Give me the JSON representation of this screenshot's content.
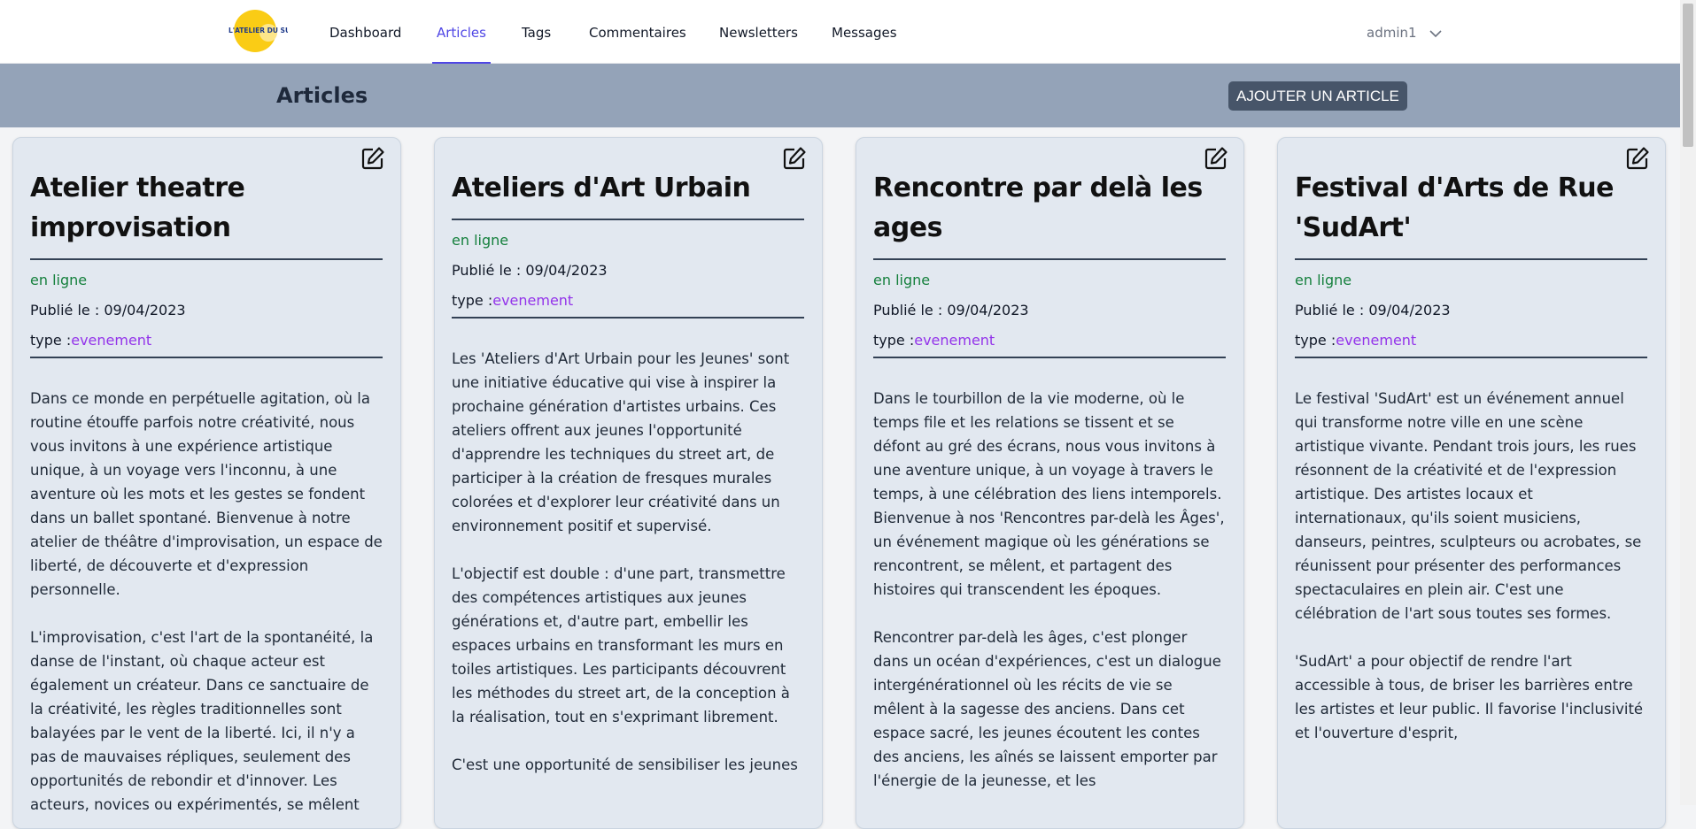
{
  "nav": {
    "items": [
      {
        "label": "Dashboard"
      },
      {
        "label": "Articles"
      },
      {
        "label": "Tags"
      },
      {
        "label": "Commentaires"
      },
      {
        "label": "Newsletters"
      },
      {
        "label": "Messages"
      }
    ],
    "active": "Articles",
    "user": "admin1"
  },
  "logo": {
    "text_line1": "L'ATELIER DU SUD"
  },
  "header": {
    "title": "Articles",
    "add_button": "AJOUTER UN ARTICLE"
  },
  "articles": [
    {
      "title": "Atelier theatre improvisation",
      "status": "en ligne",
      "published": "Publié le : 09/04/2023",
      "type_label": "type :",
      "type_value": "evenement",
      "paragraphs": [
        "Dans ce monde en perpétuelle agitation, où la routine étouffe parfois notre créativité, nous vous invitons à une expérience artistique unique, à un voyage vers l'inconnu, à une aventure où les mots et les gestes se fondent dans un ballet spontané. Bienvenue à notre atelier de théâtre d'improvisation, un espace de liberté, de découverte et d'expression personnelle.",
        "L'improvisation, c'est l'art de la spontanéité, la danse de l'instant, où chaque acteur est également un créateur. Dans ce sanctuaire de la créativité, les règles traditionnelles sont balayées par le vent de la liberté. Ici, il n'y a pas de mauvaises répliques, seulement des opportunités de rebondir et d'innover. Les acteurs, novices ou expérimentés, se mêlent"
      ]
    },
    {
      "title": "Ateliers d'Art Urbain",
      "status": "en ligne",
      "published": "Publié le : 09/04/2023",
      "type_label": "type :",
      "type_value": "evenement",
      "paragraphs": [
        "Les 'Ateliers d'Art Urbain pour les Jeunes' sont une initiative éducative qui vise à inspirer la prochaine génération d'artistes urbains. Ces ateliers offrent aux jeunes l'opportunité d'apprendre les techniques du street art, de participer à la création de fresques murales colorées et d'explorer leur créativité dans un environnement positif et supervisé.",
        "L'objectif est double : d'une part, transmettre des compétences artistiques aux jeunes générations et, d'autre part, embellir les espaces urbains en transformant les murs en toiles artistiques. Les participants découvrent les méthodes du street art, de la conception à la réalisation, tout en s'exprimant librement.",
        "C'est une opportunité de sensibiliser les jeunes"
      ]
    },
    {
      "title": "Rencontre par delà les ages",
      "status": "en ligne",
      "published": "Publié le : 09/04/2023",
      "type_label": "type :",
      "type_value": "evenement",
      "paragraphs": [
        "Dans le tourbillon de la vie moderne, où le temps file et les relations se tissent et se défont au gré des écrans, nous vous invitons à une aventure unique, à un voyage à travers le temps, à une célébration des liens intemporels. Bienvenue à nos 'Rencontres par-delà les Âges', un événement magique où les générations se rencontrent, se mêlent, et partagent des histoires qui transcendent les époques.",
        "Rencontrer par-delà les âges, c'est plonger dans un océan d'expériences, c'est un dialogue intergénérationnel où les récits de vie se mêlent à la sagesse des anciens. Dans cet espace sacré, les jeunes écoutent les contes des anciens, les aînés se laissent emporter par l'énergie de la jeunesse, et les"
      ]
    },
    {
      "title": "Festival d'Arts de Rue 'SudArt'",
      "status": "en ligne",
      "published": "Publié le : 09/04/2023",
      "type_label": "type :",
      "type_value": "evenement",
      "paragraphs": [
        "Le festival 'SudArt' est un événement annuel qui transforme notre ville en une scène artistique vivante. Pendant trois jours, les rues résonnent de la créativité et de l'expression artistique. Des artistes locaux et internationaux, qu'ils soient musiciens, danseurs, peintres, sculpteurs ou acrobates, se réunissent pour présenter des performances spectaculaires en plein air. C'est une célébration de l'art sous toutes ses formes.",
        "'SudArt' a pour objectif de rendre l'art accessible à tous, de briser les barrières entre les artistes et leur public. Il favorise l'inclusivité et l'ouverture d'esprit,"
      ]
    }
  ]
}
